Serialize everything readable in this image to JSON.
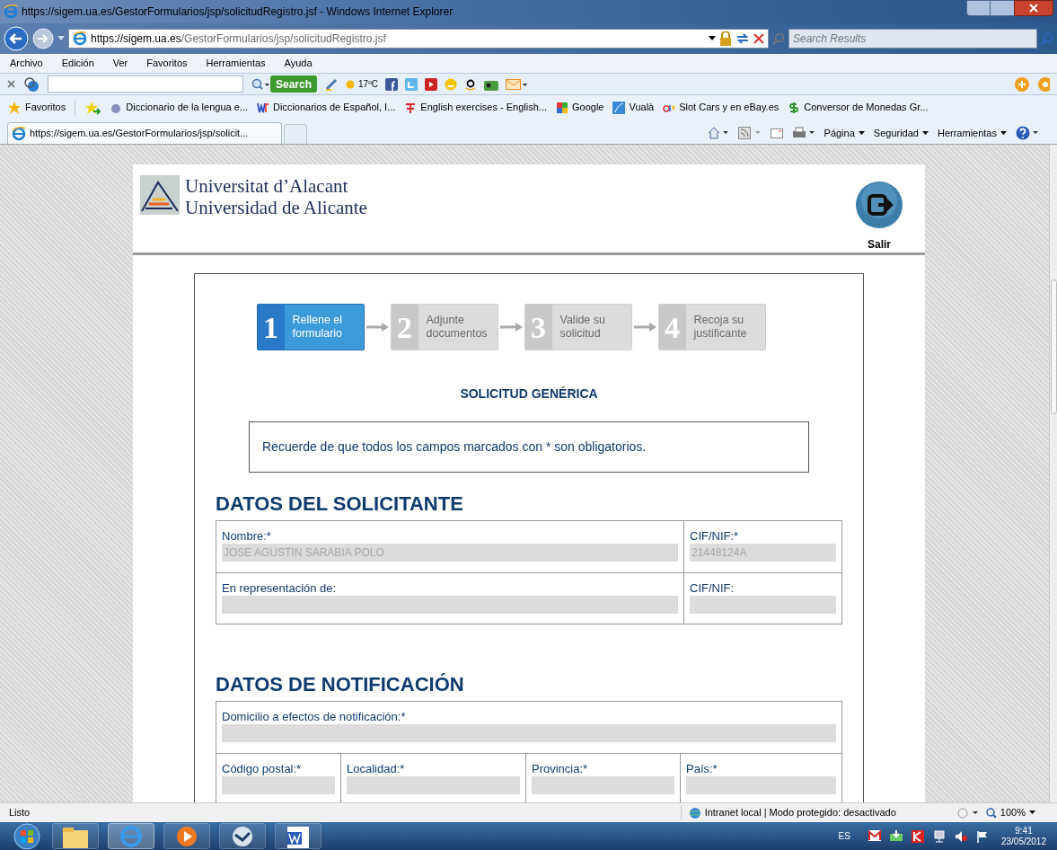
{
  "window": {
    "title": "https://sigem.ua.es/GestorFormularios/jsp/solicitudRegistro.jsf - Windows Internet Explorer"
  },
  "address": {
    "host": "https://sigem.ua.es",
    "path": "/GestorFormularios/jsp/solicitudRegistro.jsf"
  },
  "search_box": {
    "placeholder": "Search Results"
  },
  "menu": [
    "Archivo",
    "Edición",
    "Ver",
    "Favoritos",
    "Herramientas",
    "Ayuda"
  ],
  "toolbar": {
    "search_button": "Search",
    "weather": "17ºC"
  },
  "favorites": {
    "label": "Favoritos",
    "items": [
      {
        "label": "Diccionario de la lengua e..."
      },
      {
        "label": "Diccionarios de Español, I..."
      },
      {
        "label": "English exercises - English..."
      },
      {
        "label": "Google"
      },
      {
        "label": "Vualà"
      },
      {
        "label": "Slot Cars y en eBay.es"
      },
      {
        "label": "Conversor de Monedas Gr..."
      }
    ]
  },
  "tab": {
    "label": "https://sigem.ua.es/GestorFormularios/jsp/solicit..."
  },
  "command_bar": [
    "Página",
    "Seguridad",
    "Herramientas"
  ],
  "page": {
    "university": [
      "Universitat d’Alacant",
      "Universidad de Alicante"
    ],
    "exit_label": "Salir",
    "steps": [
      {
        "number": "1",
        "label": "Rellene el formulario",
        "selected": true
      },
      {
        "number": "2",
        "label": "Adjunte documentos",
        "selected": false
      },
      {
        "number": "3",
        "label": "Valide su solicitud",
        "selected": false
      },
      {
        "number": "4",
        "label": "Recoja su justificante",
        "selected": false
      }
    ],
    "form_title": "SOLICITUD GENÉRICA",
    "notice": "Recuerde de que todos los campos marcados con * son obligatorios.",
    "sections": [
      {
        "title": "DATOS DEL SOLICITANTE",
        "rows": [
          [
            {
              "label": "Nombre:*",
              "value": "JOSE AGUSTIN SARABIA POLO"
            },
            {
              "label": "CIF/NIF:*",
              "value": "21448124A"
            }
          ],
          [
            {
              "label": "En representación de:"
            },
            {
              "label": "CIF/NIF:"
            }
          ]
        ]
      },
      {
        "title": "DATOS DE NOTIFICACIÓN",
        "rows": [
          [
            {
              "label": "Domicilio a efectos de notificación:*"
            }
          ],
          [
            {
              "label": "Código postal:*"
            },
            {
              "label": "Localidad:*"
            },
            {
              "label": "Provincia:*"
            },
            {
              "label": "País:*"
            }
          ]
        ]
      }
    ]
  },
  "status_bar": {
    "text": "Listo",
    "zone": "Intranet local | Modo protegido: desactivado",
    "zoom": "100%"
  },
  "taskbar": {
    "language": "ES",
    "time": "9:41",
    "date": "23/05/2012"
  }
}
